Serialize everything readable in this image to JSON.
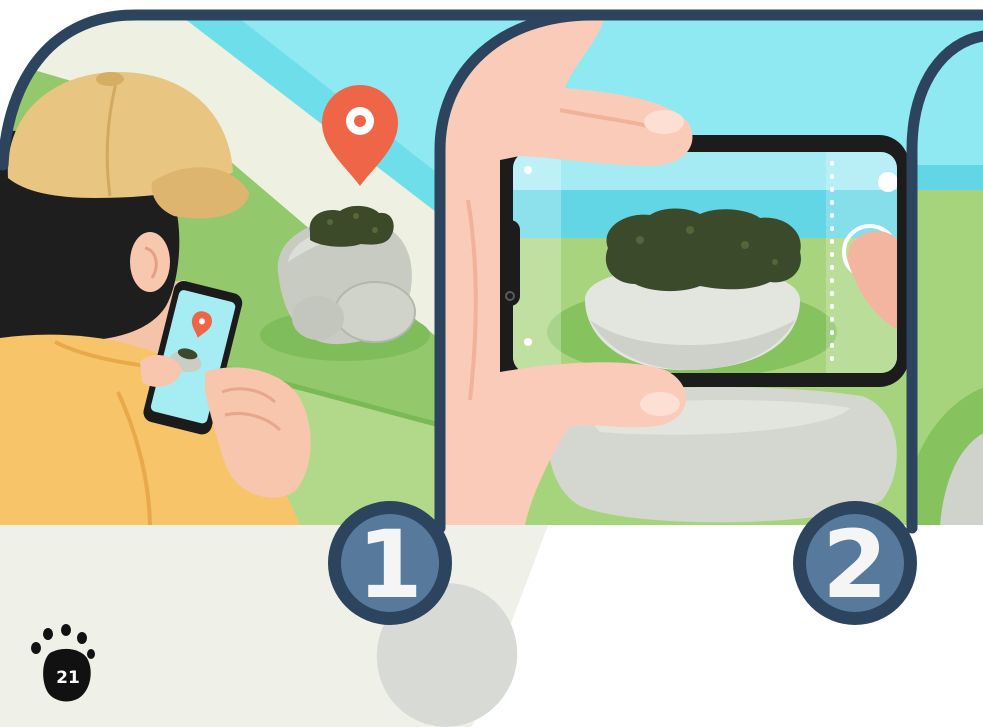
{
  "steps": [
    {
      "number": "1"
    },
    {
      "number": "2"
    }
  ],
  "logo": {
    "text": "21"
  },
  "colors": {
    "outline": "#2c445e",
    "badge_fill": "#57799c",
    "badge_text": "#f5f5f5",
    "sky": "#8ee9f3",
    "grass": "#93c86c",
    "pin": "#ef6548",
    "cap": "#e8c580",
    "shirt": "#f8c46a",
    "skin": "#f9cbb8",
    "moss": "#3c4a2c",
    "rock": "#c7cbc2",
    "logo": "#111111",
    "logo_text": "#ffffff"
  }
}
